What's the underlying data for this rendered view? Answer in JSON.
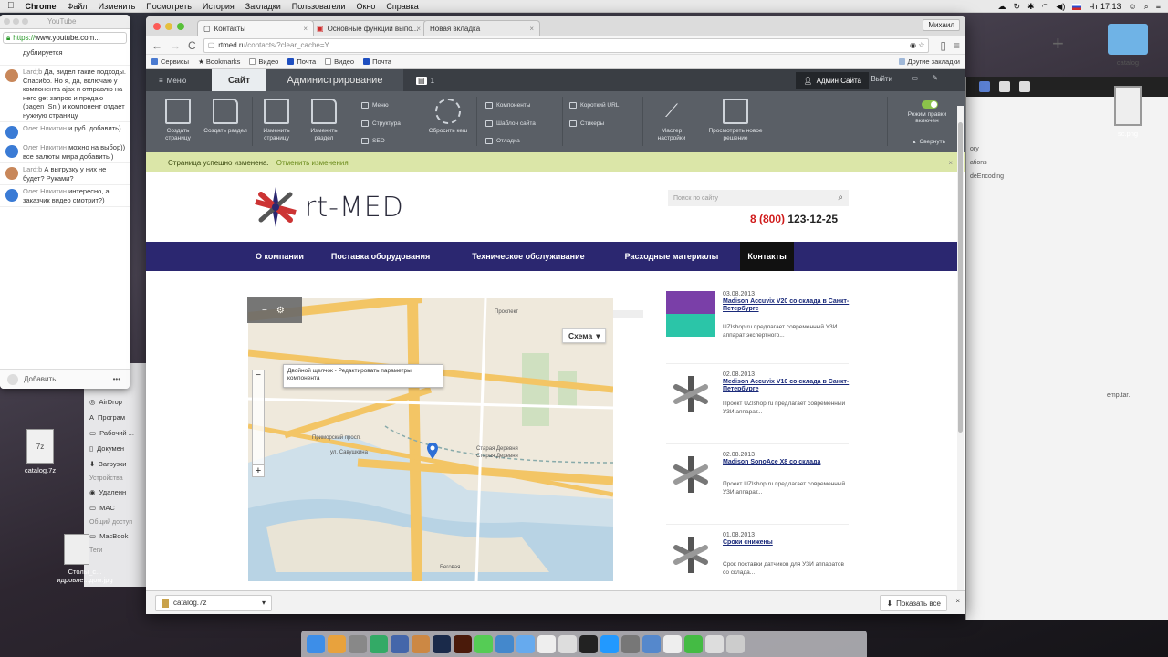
{
  "menubar": {
    "apple": "",
    "app": "Chrome",
    "items": [
      "Файл",
      "Изменить",
      "Посмотреть",
      "История",
      "Закладки",
      "Пользователи",
      "Окно",
      "Справка"
    ],
    "clock": "Чт 17:13"
  },
  "youtube_window": {
    "title": "YouTube",
    "url_scheme": "https://",
    "url_rest": "www.youtube.com...",
    "messages": [
      {
        "name": "",
        "text": "дублируется",
        "avatar": "#fff"
      },
      {
        "name": "Lard;b",
        "text": "Да, видел такие подходы. Спасибо. Но я, да, включаю у компонента ajax и отправлю на него get запрос и предаю (pagen_Sn ) и компонент отдает нужную страницу",
        "avatar": "#c8875a"
      },
      {
        "name": "Олег Никитин",
        "text": "и руб. добавить)",
        "avatar": "#3a7bd5"
      },
      {
        "name": "Олег Никитин",
        "text": "можно на выбор)) все валюты мира добавить )",
        "avatar": "#3a7bd5"
      },
      {
        "name": "Lard;b",
        "text": "А выгрузку у них не будет? Руками?",
        "avatar": "#c8875a"
      },
      {
        "name": "Олег Никитин",
        "text": "интересно, а заказчик видео смотрит?)",
        "avatar": "#3a7bd5"
      }
    ],
    "add_placeholder": "Добавить"
  },
  "finder_left": {
    "items": [
      "AirDrop",
      "Програм",
      "Рабочий ...",
      "Докумен",
      "Загрузки"
    ],
    "devices_header": "Устройства",
    "devices": [
      "Удаленн",
      "MAC"
    ],
    "shared_header": "Общий доступ",
    "shared": [
      "MacBook"
    ],
    "tags_header": "Теги"
  },
  "desktop": {
    "icons": [
      {
        "label": "catalog.7z"
      },
      {
        "label": "Столы_с...   идровле...дом.jpg"
      }
    ],
    "right_icons": [
      {
        "label": "catalog"
      },
      {
        "label": "sc.png"
      }
    ]
  },
  "right_finder": {
    "rows": [
      "ory",
      "ations",
      "deEncoding",
      "",
      "",
      "",
      "",
      "",
      "",
      "",
      "",
      "emp.tar.",
      ""
    ]
  },
  "chrome": {
    "tabs": [
      {
        "label": "Контакты",
        "active": true
      },
      {
        "label": "Основные функции выпо...",
        "active": false
      },
      {
        "label": "Новая вкладка",
        "active": false
      }
    ],
    "profile": "Михаил",
    "url_host": "rtmed.ru",
    "url_path": "/contacts/?clear_cache=Y",
    "bookmarks": [
      "Сервисы",
      "Bookmarks",
      "Видео",
      "Почта",
      "Видео",
      "Почта"
    ],
    "other_bookmarks": "Другие закладки",
    "download_file": "catalog.7z",
    "show_all": "Показать все"
  },
  "bitrix": {
    "menu": "Меню",
    "site": "Сайт",
    "admin": "Администрирование",
    "counter": "1",
    "user": "Админ Сайта",
    "exit": "Выйти",
    "tools": [
      {
        "label": "Создать страницу"
      },
      {
        "label": "Создать раздел"
      },
      {
        "label": "Изменить страницу"
      },
      {
        "label": "Изменить раздел"
      }
    ],
    "small_col1": [
      "Меню",
      "Структура",
      "SEO"
    ],
    "reset_cache": "Сбросить кеш",
    "small_col2": [
      "Компоненты",
      "Шаблон сайта",
      "Отладка"
    ],
    "small_col3": [
      "Короткий URL",
      "Стикеры"
    ],
    "wizard": "Мастер настройки",
    "preview": "Просмотреть новое решение",
    "edit_mode": "Режим правки включен",
    "collapse": "Свернуть",
    "notice": "Страница успешно изменена.",
    "notice_undo": "Отменить изменения"
  },
  "site": {
    "logo": "rt-MED",
    "search_placeholder": "Поиск по сайту",
    "phone_code": "8 (800)",
    "phone_num": "123-12-25",
    "nav": [
      "О компании",
      "Поставка оборудования",
      "Техническое обслуживание",
      "Расходные материалы",
      "Контакты"
    ],
    "map_title": "ТЫ",
    "map_scheme": "Схема",
    "map_tooltip": "Двойной щелчок - Редактировать параметры компонента",
    "map_labels": [
      "Приморский просп.",
      "ул. Савушкина",
      "Старая Деревня",
      "Старая Деревня",
      "Беговая",
      "Проспект"
    ],
    "news": [
      {
        "date": "03.08.2013",
        "title": "Madison Accuvix V20 со склада в Санкт-Петербурге",
        "desc": "UZIshop.ru предлагает современный УЗИ аппарат экспертного..."
      },
      {
        "date": "02.08.2013",
        "title": "Medison Accuvix V10 со склада в Санкт-Петербурге",
        "desc": "Проект UZIshop.ru предлагает современный УЗИ аппарат..."
      },
      {
        "date": "02.08.2013",
        "title": "Madison SonoAce X8 со склада",
        "desc": "Проект UZIshop.ru предлагает современный УЗИ аппарат..."
      },
      {
        "date": "01.08.2013",
        "title": "Сроки снижены",
        "desc": "Срок поставки датчиков для УЗИ аппаратов со склада..."
      }
    ]
  },
  "colors": {
    "nav": "#2b2770",
    "phone_code": "#d01b1b",
    "notice": "#dbe6a8",
    "admin_panel": "#5a5f66"
  }
}
